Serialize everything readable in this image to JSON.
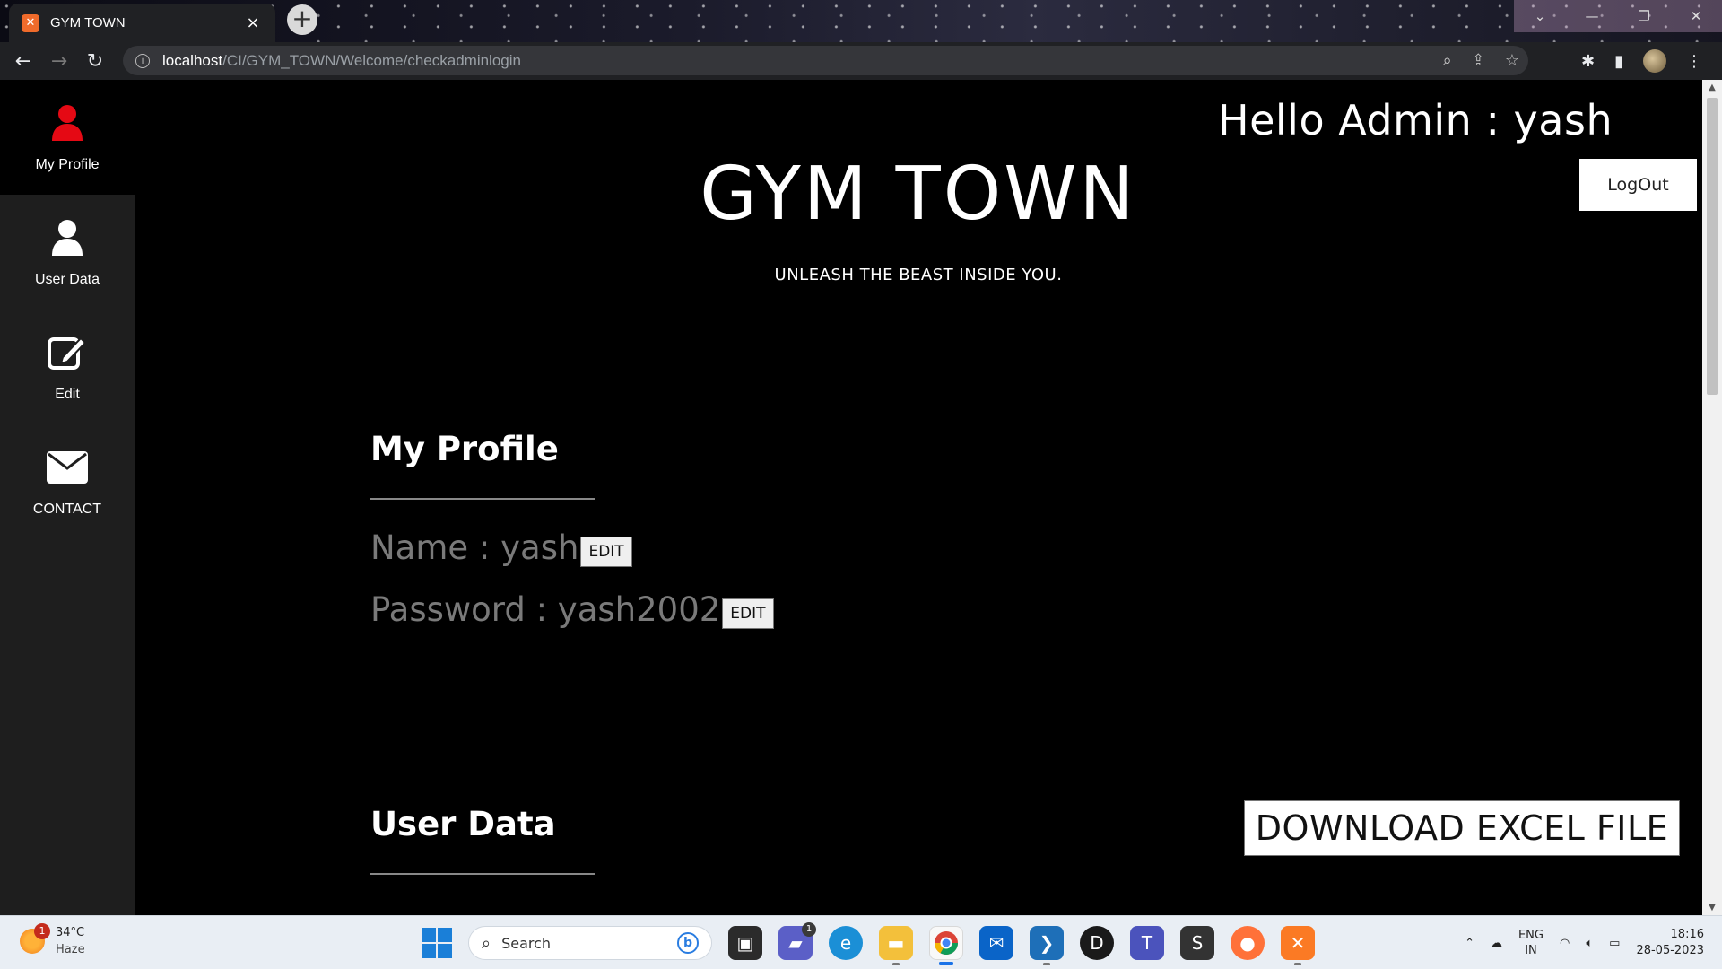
{
  "browser": {
    "tab_title": "GYM TOWN",
    "tab_close": "×",
    "new_tab": "+",
    "url_host": "localhost",
    "url_path": "/CI/GYM_TOWN/Welcome/checkadminlogin"
  },
  "sidebar": {
    "items": [
      {
        "label": "My Profile",
        "icon": "user-icon",
        "active": true,
        "icon_color": "#e50914"
      },
      {
        "label": "User Data",
        "icon": "user-icon",
        "active": false
      },
      {
        "label": "Edit",
        "icon": "edit-icon",
        "active": false
      },
      {
        "label": "CONTACT",
        "icon": "envelope-icon",
        "active": false
      }
    ]
  },
  "header": {
    "greeting": "Hello Admin : yash",
    "logout_label": "LogOut",
    "brand": "GYM TOWN",
    "tagline": "UNLEASH THE BEAST INSIDE YOU."
  },
  "profile": {
    "title": "My Profile",
    "name_text": "Name : yash",
    "password_text": "Password : yash2002",
    "edit_label": "EDIT"
  },
  "user_data": {
    "title": "User Data",
    "download_label": "DOWNLOAD EXCEL FILE"
  },
  "taskbar": {
    "weather_temp": "34°C",
    "weather_desc": "Haze",
    "weather_badge": "1",
    "search_label": "Search",
    "chat_badge": "1",
    "lang_top": "ENG",
    "lang_bottom": "IN",
    "time": "18:16",
    "date": "28-05-2023"
  },
  "colors": {
    "accent_red": "#e50914",
    "page_bg": "#000000",
    "sidebar_bg": "#1e1e1e"
  }
}
